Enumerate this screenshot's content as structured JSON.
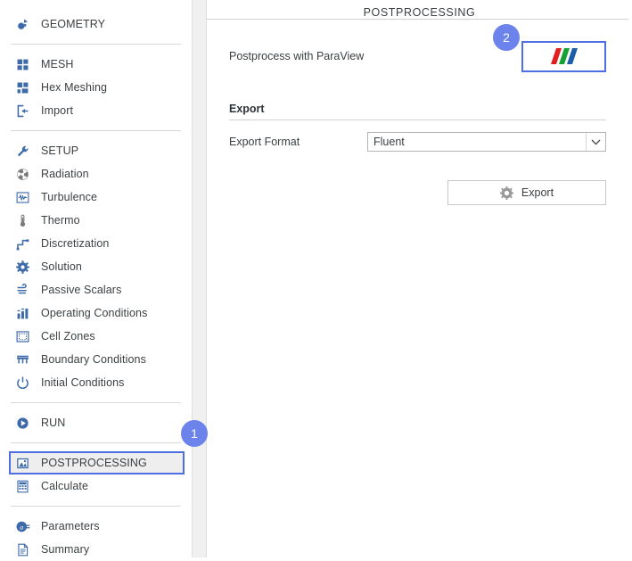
{
  "sidebar": {
    "groups": [
      {
        "items": [
          {
            "label": "GEOMETRY",
            "icon": "geometry-icon",
            "name": "sidebar-item-geometry",
            "selected": false
          }
        ]
      },
      {
        "items": [
          {
            "label": "MESH",
            "icon": "mesh-icon",
            "name": "sidebar-item-mesh",
            "selected": false
          },
          {
            "label": "Hex Meshing",
            "icon": "hex-meshing-icon",
            "name": "sidebar-item-hex-meshing",
            "selected": false
          },
          {
            "label": "Import",
            "icon": "import-icon",
            "name": "sidebar-item-import",
            "selected": false
          }
        ]
      },
      {
        "items": [
          {
            "label": "SETUP",
            "icon": "wrench-icon",
            "name": "sidebar-item-setup",
            "selected": false
          },
          {
            "label": "Radiation",
            "icon": "radiation-icon",
            "name": "sidebar-item-radiation",
            "selected": false
          },
          {
            "label": "Turbulence",
            "icon": "turbulence-icon",
            "name": "sidebar-item-turbulence",
            "selected": false
          },
          {
            "label": "Thermo",
            "icon": "thermometer-icon",
            "name": "sidebar-item-thermo",
            "selected": false
          },
          {
            "label": "Discretization",
            "icon": "discretization-icon",
            "name": "sidebar-item-discretization",
            "selected": false
          },
          {
            "label": "Solution",
            "icon": "gear-icon",
            "name": "sidebar-item-solution",
            "selected": false
          },
          {
            "label": "Passive Scalars",
            "icon": "wind-icon",
            "name": "sidebar-item-passive-scalars",
            "selected": false
          },
          {
            "label": "Operating Conditions",
            "icon": "bar-chart-icon",
            "name": "sidebar-item-operating-conditions",
            "selected": false
          },
          {
            "label": "Cell Zones",
            "icon": "cell-zones-icon",
            "name": "sidebar-item-cell-zones",
            "selected": false
          },
          {
            "label": "Boundary Conditions",
            "icon": "boundary-icon",
            "name": "sidebar-item-boundary-conditions",
            "selected": false
          },
          {
            "label": "Initial Conditions",
            "icon": "power-icon",
            "name": "sidebar-item-initial-conditions",
            "selected": false
          }
        ]
      },
      {
        "items": [
          {
            "label": "RUN",
            "icon": "play-icon",
            "name": "sidebar-item-run",
            "selected": false
          }
        ]
      },
      {
        "items": [
          {
            "label": "POSTPROCESSING",
            "icon": "image-icon",
            "name": "sidebar-item-postprocessing",
            "selected": true
          },
          {
            "label": "Calculate",
            "icon": "calculator-icon",
            "name": "sidebar-item-calculate",
            "selected": false
          }
        ]
      },
      {
        "items": [
          {
            "label": "Parameters",
            "icon": "parameters-icon",
            "name": "sidebar-item-parameters",
            "selected": false
          },
          {
            "label": "Summary",
            "icon": "document-icon",
            "name": "sidebar-item-summary",
            "selected": false
          }
        ]
      }
    ]
  },
  "main": {
    "title": "POSTPROCESSING",
    "paraview": {
      "label": "Postprocess with ParaView",
      "button_icon": "paraview-logo-icon",
      "logo_colors": [
        "#e02020",
        "#16a036",
        "#1c5fa8"
      ]
    },
    "export": {
      "section_title": "Export",
      "format_label": "Export Format",
      "format_value": "Fluent",
      "format_options": [
        "Fluent"
      ],
      "button_label": "Export",
      "button_icon": "gear-icon"
    }
  },
  "badges": [
    {
      "label": "1",
      "name": "annotation-badge-1"
    },
    {
      "label": "2",
      "name": "annotation-badge-2"
    }
  ],
  "colors": {
    "accent": "#4d6fe3",
    "badge": "#6b83ea",
    "icon": "#3d6aa8",
    "text": "#3c4043"
  }
}
